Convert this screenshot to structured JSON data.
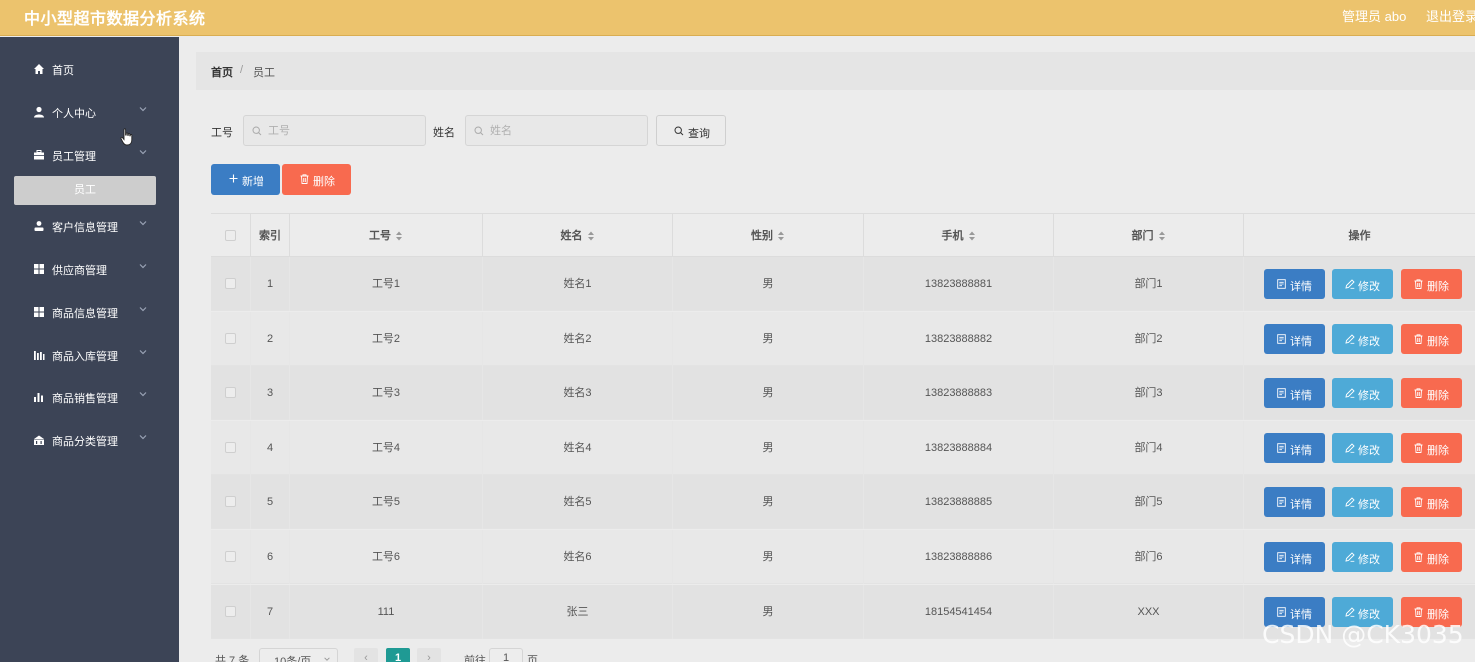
{
  "header": {
    "title": "中小型超市数据分析系统",
    "user": "管理员 abo",
    "logout": "退出登录"
  },
  "sidebar": {
    "items": [
      {
        "label": "首页",
        "icon": "home-icon"
      },
      {
        "label": "个人中心",
        "icon": "user-icon"
      },
      {
        "label": "员工管理",
        "icon": "briefcase-icon"
      },
      {
        "label": "客户信息管理",
        "icon": "person-icon"
      },
      {
        "label": "供应商管理",
        "icon": "grid-icon"
      },
      {
        "label": "商品信息管理",
        "icon": "grid-icon"
      },
      {
        "label": "商品入库管理",
        "icon": "bar-chart-icon"
      },
      {
        "label": "商品销售管理",
        "icon": "bar-chart-icon"
      },
      {
        "label": "商品分类管理",
        "icon": "bank-icon"
      }
    ],
    "active_sub": "员工"
  },
  "breadcrumb": {
    "home": "首页",
    "sep": "/",
    "current": "员工"
  },
  "search": {
    "id_label": "工号",
    "id_placeholder": "工号",
    "name_label": "姓名",
    "name_placeholder": "姓名",
    "query_label": "查询"
  },
  "toolbar": {
    "add_label": "新增",
    "delete_label": "删除"
  },
  "table": {
    "headers": [
      "索引",
      "工号",
      "姓名",
      "性别",
      "手机",
      "部门",
      "操作"
    ],
    "actions": {
      "detail": "详情",
      "edit": "修改",
      "remove": "删除"
    },
    "rows": [
      {
        "index": "1",
        "id": "工号1",
        "name": "姓名1",
        "gender": "男",
        "phone": "13823888881",
        "dept": "部门1"
      },
      {
        "index": "2",
        "id": "工号2",
        "name": "姓名2",
        "gender": "男",
        "phone": "13823888882",
        "dept": "部门2"
      },
      {
        "index": "3",
        "id": "工号3",
        "name": "姓名3",
        "gender": "男",
        "phone": "13823888883",
        "dept": "部门3"
      },
      {
        "index": "4",
        "id": "工号4",
        "name": "姓名4",
        "gender": "男",
        "phone": "13823888884",
        "dept": "部门4"
      },
      {
        "index": "5",
        "id": "工号5",
        "name": "姓名5",
        "gender": "男",
        "phone": "13823888885",
        "dept": "部门5"
      },
      {
        "index": "6",
        "id": "工号6",
        "name": "姓名6",
        "gender": "男",
        "phone": "13823888886",
        "dept": "部门6"
      },
      {
        "index": "7",
        "id": "111",
        "name": "张三",
        "gender": "男",
        "phone": "18154541454",
        "dept": "XXX"
      }
    ]
  },
  "pagination": {
    "total": "共 7 条",
    "page_size": "10条/页",
    "current_page": "1",
    "goto_label": "前往",
    "goto_value": "1",
    "page_suffix": "页"
  },
  "watermark": "CSDN @CK3035",
  "colors": {
    "header_bg": "#ecc36d",
    "sidebar_bg": "#3c4456",
    "primary": "#3b7dc4",
    "info": "#4eaad7",
    "danger": "#f86a4f",
    "page_active": "#1f9a94"
  }
}
